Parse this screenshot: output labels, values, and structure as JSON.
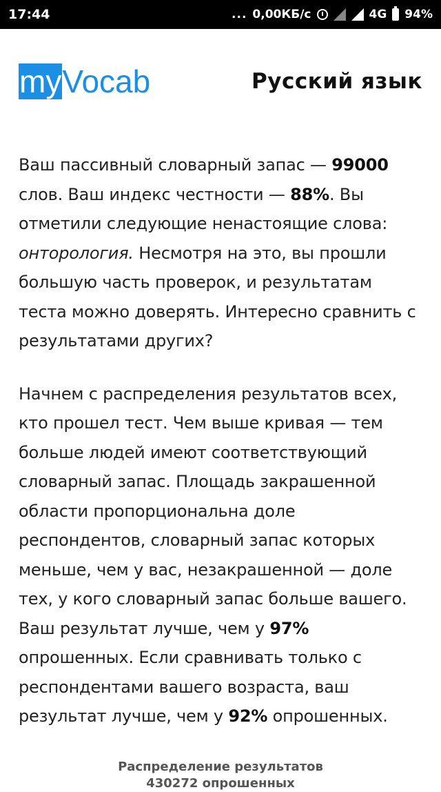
{
  "status_bar": {
    "time": "17:44",
    "dots": "...",
    "network_speed": "0,00КБ/с",
    "network_type": "4G",
    "battery": "94%",
    "icons": [
      "alarm-icon",
      "signal-icon",
      "battery-icon"
    ]
  },
  "header": {
    "logo_part1": "my",
    "logo_part2": "Vocab",
    "language": "Русский язык",
    "brand_color": "#1a8fe3"
  },
  "paragraph1": {
    "t1": "Ваш пассивный словарный запас — ",
    "vocab": "99000",
    "t2": " слов. Ваш индекс честности — ",
    "honesty": "88%",
    "t3": ". Вы отметили следующие ненастоящие слова: ",
    "fake_word": "онторология.",
    "t4": " Несмотря на это, вы прошли большую часть проверок, и результатам теста можно доверять. Интересно сравнить с результатами других?"
  },
  "paragraph2": {
    "t1": "Начнем с распределения результатов всех, кто прошел тест. Чем выше кривая — тем больше людей имеют соответствующий словарный запас. Площадь закрашенной области пропорциональна доле респондентов, словарный запас которых меньше, чем у вас, незакрашенной — доле тех, у кого словарный запас больше вашего. Ваш результат лучше, чем у ",
    "pct_all": "97%",
    "t2": " опрошенных. Если сравнивать только с респондентами вашего возраста, ваш результат лучше, чем у ",
    "pct_age": "92%",
    "t3": " опрошенных."
  },
  "distribution_caption": {
    "line1": "Распределение результатов",
    "line2": "430272 опрошенных"
  }
}
